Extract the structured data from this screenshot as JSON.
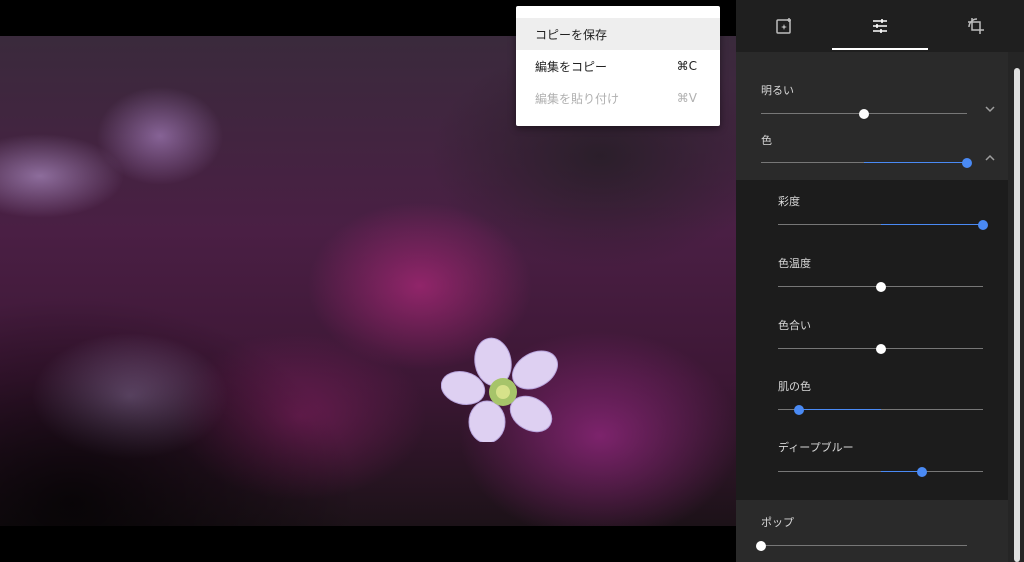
{
  "context_menu": {
    "items": [
      {
        "label": "コピーを保存",
        "shortcut": "",
        "highlighted": true,
        "disabled": false
      },
      {
        "label": "編集をコピー",
        "shortcut": "⌘C",
        "highlighted": false,
        "disabled": false
      },
      {
        "label": "編集を貼り付け",
        "shortcut": "⌘V",
        "highlighted": false,
        "disabled": true
      }
    ]
  },
  "toolbar": {
    "tools": [
      {
        "icon": "auto-enhance-icon",
        "active": false
      },
      {
        "icon": "adjust-sliders-icon",
        "active": true
      },
      {
        "icon": "crop-rotate-icon",
        "active": false
      }
    ]
  },
  "adjustments": {
    "light": {
      "label": "明るい",
      "value": 0.5,
      "expanded": false
    },
    "color": {
      "label": "色",
      "value": 1.0,
      "expanded": true
    },
    "saturation": {
      "label": "彩度",
      "value": 1.0
    },
    "warmth": {
      "label": "色温度",
      "value": 0.5
    },
    "tint": {
      "label": "色合い",
      "value": 0.5
    },
    "skin_tone": {
      "label": "肌の色",
      "value": 0.1
    },
    "deep_blue": {
      "label": "ディープブルー",
      "value": 0.7
    },
    "pop": {
      "label": "ポップ",
      "value": 0.0
    }
  },
  "colors": {
    "accent": "#4a8af4",
    "knob_white": "#ffffff",
    "panel_bg": "#252525"
  }
}
